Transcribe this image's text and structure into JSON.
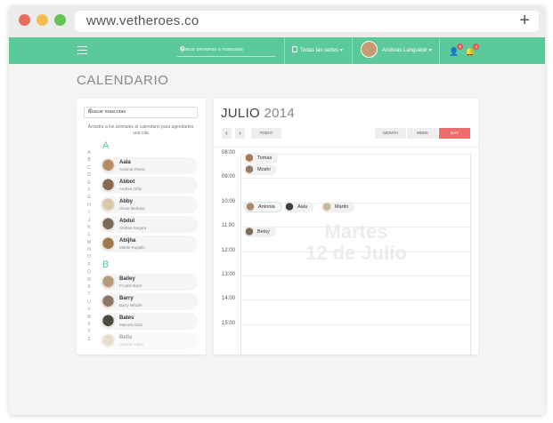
{
  "browser": {
    "url": "www.vetheroes.co",
    "new_tab": "+"
  },
  "topnav": {
    "search_placeholder": "Buscar personas o mascotas",
    "sedes_label": "Todas las sedes",
    "user_name": "Andreas Languetér",
    "notif_badge_1": "6",
    "notif_badge_2": "3",
    "accent_color": "#5cc99a"
  },
  "page_title": "CALENDARIO",
  "pets_panel": {
    "search_placeholder": "Buscar mascotas",
    "hint": "Arrastra a los animales al calendario para agendarles una cita",
    "alphabet": [
      "A",
      "B",
      "C",
      "D",
      "E",
      "F",
      "G",
      "H",
      "I",
      "J",
      "K",
      "L",
      "M",
      "N",
      "O",
      "P",
      "Q",
      "R",
      "S",
      "T",
      "U",
      "V",
      "W",
      "X",
      "Y",
      "Z"
    ],
    "sections": [
      {
        "letter": "A",
        "pets": [
          {
            "name": "Aala",
            "owner": "Antonia Perea",
            "color": "#b58b63"
          },
          {
            "name": "Abbot",
            "owner": "Andrea Ortiz",
            "color": "#8a6a52"
          },
          {
            "name": "Abby",
            "owner": "Oscar Bedoya",
            "color": "#d9c9a8"
          },
          {
            "name": "Abdul",
            "owner": "Andrea Segura",
            "color": "#7c6a5c"
          },
          {
            "name": "Abijha",
            "owner": "Martin Kopplin",
            "color": "#a07a4e"
          }
        ]
      },
      {
        "letter": "B",
        "pets": [
          {
            "name": "Bailey",
            "owner": "Frootie Bach",
            "color": "#b59a7c"
          },
          {
            "name": "Barry",
            "owner": "Barry Whizle",
            "color": "#8c7766"
          },
          {
            "name": "Bates",
            "owner": "Marcelo Diaz",
            "color": "#4a4a3e"
          },
          {
            "name": "Bella",
            "owner": "Claudia Uribe",
            "color": "#c9b496"
          }
        ]
      }
    ]
  },
  "calendar": {
    "month": "JULIO",
    "year": "2014",
    "prev": "‹",
    "next": "›",
    "today_label": "TODAY",
    "views": [
      {
        "label": "MONTH",
        "active": false
      },
      {
        "label": "WEEK",
        "active": false
      },
      {
        "label": "DAY",
        "active": true
      }
    ],
    "day_line1": "Martes",
    "day_line2": "12 de Julio",
    "hours": [
      "08:00",
      "09:00",
      "10:00",
      "11:00",
      "12:00",
      "13:00",
      "14:00",
      "15:00"
    ],
    "events": [
      {
        "name": "Tomas",
        "color": "#a57a55"
      },
      {
        "name": "Moshi",
        "color": "#8f7b68"
      },
      {
        "name": "Antonia",
        "color": "#b08a68"
      },
      {
        "name": "Aala",
        "color": "#3e3e3e"
      },
      {
        "name": "Martin",
        "color": "#c7b89a"
      },
      {
        "name": "Betsy",
        "color": "#7d6a58"
      }
    ],
    "day_color": "#ef6c6c"
  }
}
